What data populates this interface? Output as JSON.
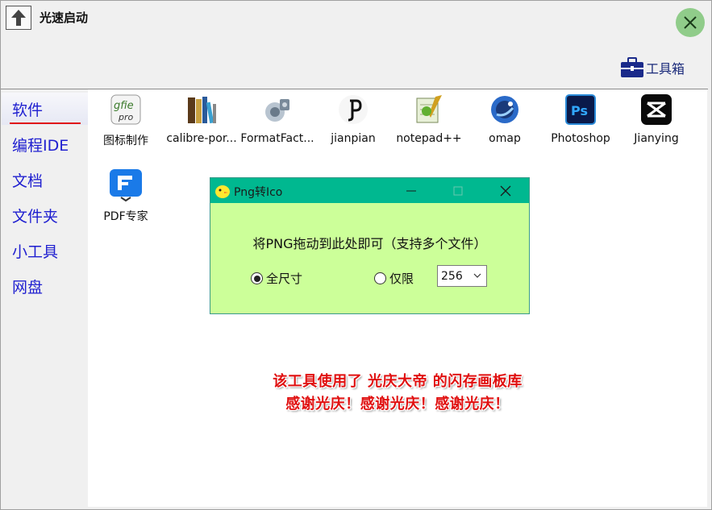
{
  "window": {
    "title": "光速启动"
  },
  "toolbox": {
    "label": "工具箱",
    "icon": "briefcase-icon"
  },
  "sidebar": {
    "items": [
      {
        "label": "软件",
        "active": true
      },
      {
        "label": "编程IDE",
        "active": false
      },
      {
        "label": "文档",
        "active": false
      },
      {
        "label": "文件夹",
        "active": false
      },
      {
        "label": "小工具",
        "active": false
      },
      {
        "label": "网盘",
        "active": false
      }
    ]
  },
  "apps": [
    {
      "label": "图标制作",
      "icon": "gfie-icon"
    },
    {
      "label": "calibre-por...",
      "icon": "calibre-icon"
    },
    {
      "label": "FormatFact...",
      "icon": "formatfactory-icon"
    },
    {
      "label": "jianpian",
      "icon": "jianpian-icon"
    },
    {
      "label": "notepad++",
      "icon": "notepadpp-icon"
    },
    {
      "label": "omap",
      "icon": "omap-icon"
    },
    {
      "label": "Photoshop",
      "icon": "photoshop-icon"
    },
    {
      "label": "Jianying",
      "icon": "jianying-icon"
    },
    {
      "label": "PDF专家",
      "icon": "pdf-expert-icon"
    }
  ],
  "dialog": {
    "title": "Png转Ico",
    "prompt": "将PNG拖动到此处即可（支持多个文件）",
    "options": {
      "full_size_label": "全尺寸",
      "limit_label": "仅限",
      "selected": "全尺寸"
    },
    "size_value": "256"
  },
  "credits": {
    "line1": "该工具使用了 光庆大帝 的闪存画板库",
    "line2": "感谢光庆！感谢光庆！感谢光庆！"
  },
  "colors": {
    "accent_blue": "#2020d0",
    "active_underline": "#e01818",
    "dialog_titlebar": "#00b890",
    "dialog_body": "#ccff99",
    "credit_red": "#e01010",
    "close_button": "#90cc8a"
  }
}
